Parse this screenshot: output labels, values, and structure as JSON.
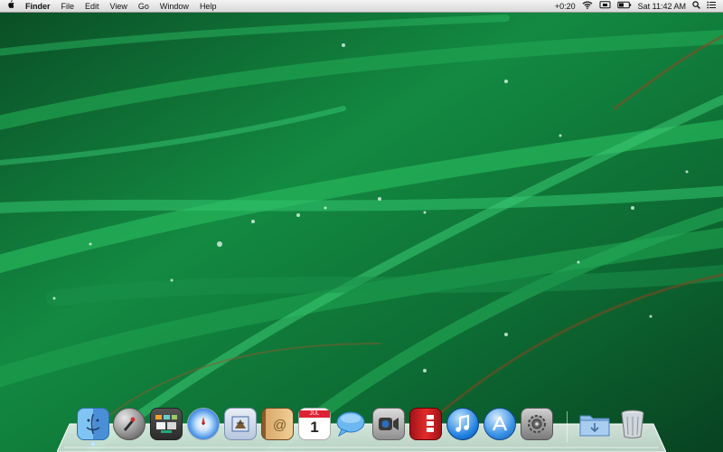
{
  "menubar": {
    "app_name": "Finder",
    "menus": [
      "File",
      "Edit",
      "View",
      "Go",
      "Window",
      "Help"
    ],
    "status": {
      "volume_text": "+0:20",
      "clock": "Sat 11:42 AM"
    },
    "icons": [
      "apple-icon",
      "wifi-icon",
      "display-icon",
      "battery-icon",
      "search-icon",
      "list-icon"
    ]
  },
  "dock": {
    "apps": [
      {
        "name": "finder-icon"
      },
      {
        "name": "launchpad-icon"
      },
      {
        "name": "mission-control-icon"
      },
      {
        "name": "safari-icon"
      },
      {
        "name": "mail-icon"
      },
      {
        "name": "contacts-icon"
      },
      {
        "name": "calendar-icon",
        "label": "1",
        "month": "JUL"
      },
      {
        "name": "messages-icon"
      },
      {
        "name": "facetime-icon"
      },
      {
        "name": "photo-booth-icon"
      },
      {
        "name": "itunes-icon"
      },
      {
        "name": "app-store-icon"
      },
      {
        "name": "system-preferences-icon"
      },
      {
        "name": "downloads-folder-icon"
      },
      {
        "name": "trash-icon"
      }
    ]
  },
  "colors": {
    "dock_glass": "#e8f3ee",
    "wallpaper_green": "#137a3c"
  }
}
